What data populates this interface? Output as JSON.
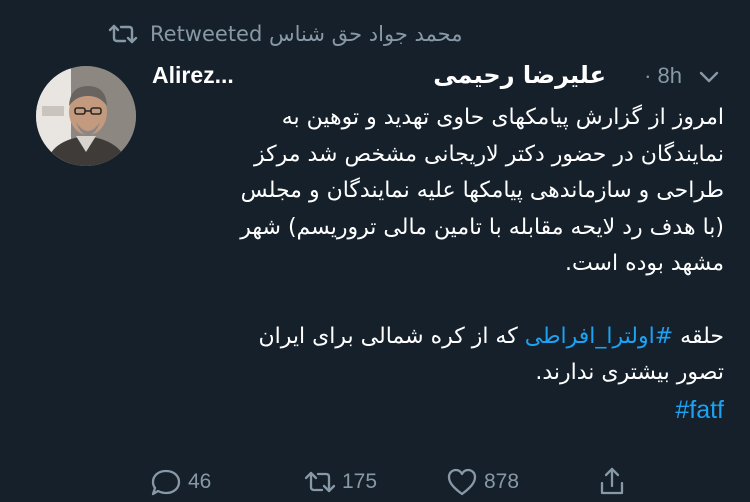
{
  "retweet_banner": {
    "icon": "retweet-icon",
    "text": "محمد جواد حق شناس Retweeted"
  },
  "tweet": {
    "author": {
      "display_name_latin": "Alirez...",
      "display_name_farsi": "علیرضا رحیمی",
      "avatar": "avatar"
    },
    "timestamp": "· 8h",
    "lines": [
      "امروز از گزارش پیامکهای حاوی تهدید و توهین به",
      "نمایندگان در حضور دکتر لاریجانی مشخص شد مرکز",
      "طراحی و سازماندهی پیامکها علیه نمایندگان و مجلس",
      "(با هدف رد لایحه مقابله با تامین مالی تروریسم) شهر",
      "مشهد بوده است."
    ],
    "second_paragraph": {
      "prefix": "حلقه ",
      "hashtag": "#اولترا_افراطی",
      "suffix": " که از کره شمالی برای ایران",
      "line2": "تصور بیشتری ندارند.",
      "hashtag2": "#fatf"
    }
  },
  "actions": {
    "reply": {
      "icon": "reply-icon",
      "count": "46"
    },
    "retweet": {
      "icon": "retweet-icon",
      "count": "175"
    },
    "like": {
      "icon": "heart-icon",
      "count": "878"
    },
    "share": {
      "icon": "share-icon"
    }
  },
  "colors": {
    "background": "#15202b",
    "text": "#ffffff",
    "secondary": "#8899a6",
    "link": "#1da1f2"
  }
}
